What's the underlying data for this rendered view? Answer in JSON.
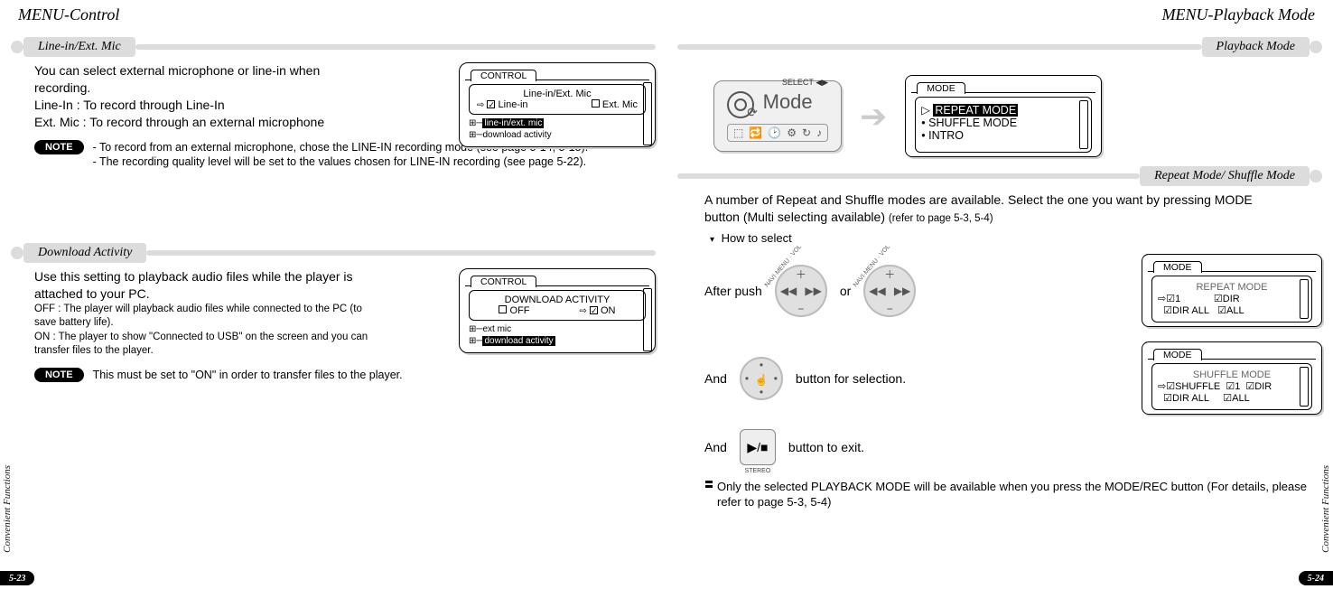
{
  "left": {
    "title": "MENU-Control",
    "side_label": "Convenient Functions",
    "page_num": "5-23",
    "section1": {
      "heading": "Line-in/Ext. Mic",
      "intro": "You can select external microphone or line-in when recording.",
      "line1": "Line-In : To record through Line-In",
      "line2": "Ext. Mic : To record through an external microphone",
      "note_label": "NOTE",
      "note1": "- To record from an external microphone, chose the LINE-IN recording mode (see page 5-14, 5-15).",
      "note2": "- The recording quality level will be set to the values chosen for LINE-IN recording (see page 5-22).",
      "lcd": {
        "tab": "CONTROL",
        "title": "Line-in/Ext. Mic",
        "opt1": "Line-in",
        "opt2": "Ext. Mic",
        "tree1": "line-in/ext. mic",
        "tree2": "download activity"
      }
    },
    "section2": {
      "heading": "Download Activity",
      "intro": "Use this setting to playback audio files while the player is attached to your PC.",
      "line1": "OFF : The player will playback audio files while connected to the PC (to save battery life).",
      "line2": "ON : The player to show \"Connected to USB\" on the screen and you can transfer files to the player.",
      "note_label": "NOTE",
      "note1": "This must be set to \"ON\" in order to transfer files to the player.",
      "lcd": {
        "tab": "CONTROL",
        "title": "DOWNLOAD ACTIVITY",
        "opt1": "OFF",
        "opt2": "ON",
        "tree1": "ext mic",
        "tree2": "download activity"
      }
    }
  },
  "right": {
    "title": "MENU-Playback Mode",
    "side_label": "Convenient Functions",
    "page_num": "5-24",
    "section1_heading": "Playback Mode",
    "mode_card": {
      "select": "SELECT ◀▶",
      "label": "Mode"
    },
    "mode_lcd": {
      "tab": "MODE",
      "item1": "REPEAT MODE",
      "item2": "SHUFFLE MODE",
      "item3": "INTRO"
    },
    "section2": {
      "heading": "Repeat Mode/ Shuffle Mode",
      "intro": "A number of Repeat and Shuffle modes are available. Select the one you want by pressing MODE button (Multi selecting available)",
      "intro_ref": "(refer to page 5-3, 5-4)",
      "how": "How to select",
      "step1_a": "After push",
      "step1_b": "or",
      "step2_a": "And",
      "step2_b": "button for selection.",
      "step3_a": "And",
      "step3_b": "button to exit.",
      "footnote": "Only the selected PLAYBACK MODE will be available when you press the MODE/REC button (For details, please refer to page 5-3, 5-4)"
    },
    "repeat_lcd": {
      "tab": "MODE",
      "title": "REPEAT MODE",
      "o1": "1",
      "o2": "DIR",
      "o3": "DIR ALL",
      "o4": "ALL"
    },
    "shuffle_lcd": {
      "tab": "MODE",
      "title": "SHUFFLE MODE",
      "o1": "SHUFFLE",
      "o2": "1",
      "o3": "DIR",
      "o4": "DIR ALL",
      "o5": "ALL"
    }
  }
}
